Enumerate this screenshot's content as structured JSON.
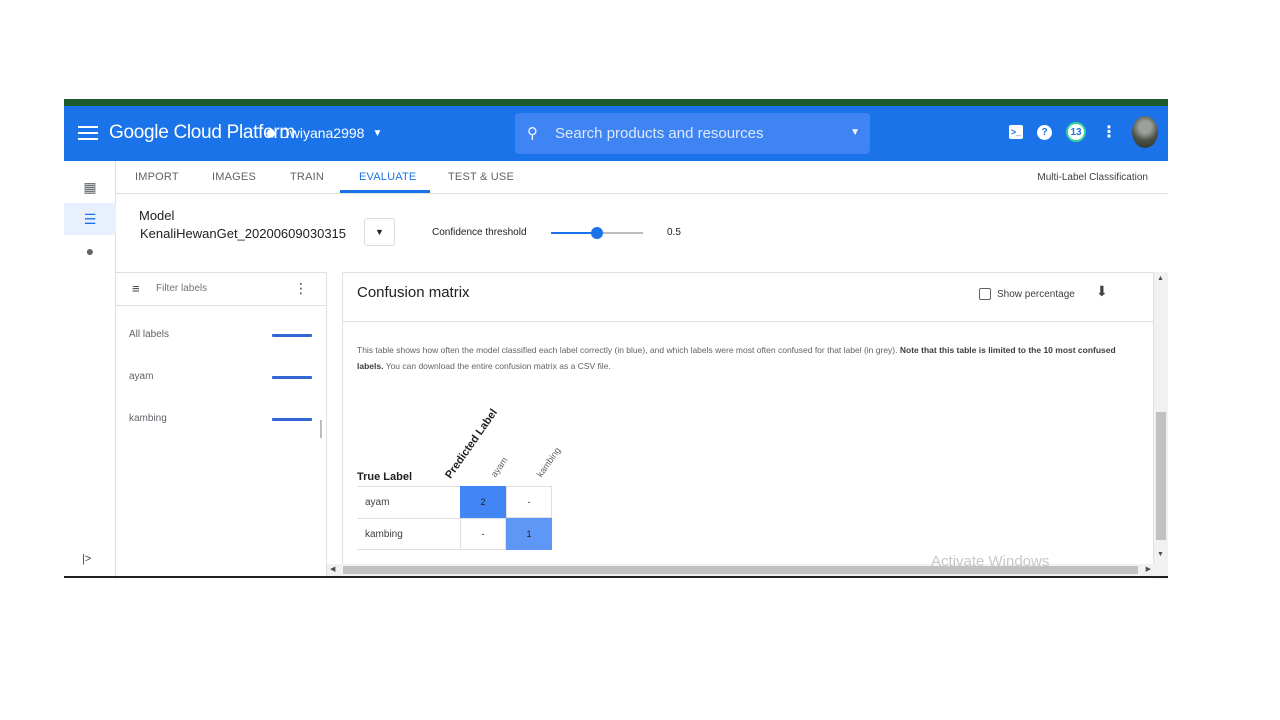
{
  "header": {
    "brand": "Google Cloud Platform",
    "project": "Dwiyana2998",
    "search_placeholder": "Search products and resources",
    "notifications_count": "13",
    "icons": [
      "menu-icon",
      "project-dots-icon",
      "search-icon",
      "cloud-shell-icon",
      "help-icon",
      "more-vert-icon",
      "avatar"
    ]
  },
  "leftnav": {
    "items": [
      "dashboard-icon",
      "list-icon",
      "lightbulb-icon"
    ],
    "active_index": 1,
    "expand": "expand-icon"
  },
  "tabs": {
    "items": [
      "IMPORT",
      "IMAGES",
      "TRAIN",
      "EVALUATE",
      "TEST & USE"
    ],
    "active": "EVALUATE",
    "right_label": "Multi-Label Classification"
  },
  "model": {
    "label": "Model",
    "value": "KenaliHewanGet_20200609030315",
    "confidence_label": "Confidence threshold",
    "confidence_value": "0.5",
    "confidence_fraction": 0.5
  },
  "filter": {
    "placeholder": "Filter labels",
    "labels": [
      "All labels",
      "ayam",
      "kambing"
    ]
  },
  "matrix": {
    "title": "Confusion matrix",
    "show_percentage": "Show percentage",
    "description_plain": "This table shows how often the model classified each label correctly (in blue), and which labels were most often confused for that label (in grey).",
    "description_bold": "Note that this table is limited to the 10 most confused labels.",
    "description_tail": "You can download the entire confusion matrix as a CSV file.",
    "predicted_label": "Predicted Label",
    "true_label": "True Label",
    "columns": [
      "ayam",
      "kambing"
    ],
    "rows": [
      {
        "label": "ayam",
        "cells": [
          "2",
          "-"
        ]
      },
      {
        "label": "kambing",
        "cells": [
          "-",
          "1"
        ]
      }
    ],
    "highlight_color": "#4285f4"
  },
  "overlay": {
    "watermark": "Activate Windows"
  },
  "colors": {
    "header_blue": "#1a73e8",
    "accent_blue": "#4285f4",
    "top_green": "#1e5b2c"
  }
}
